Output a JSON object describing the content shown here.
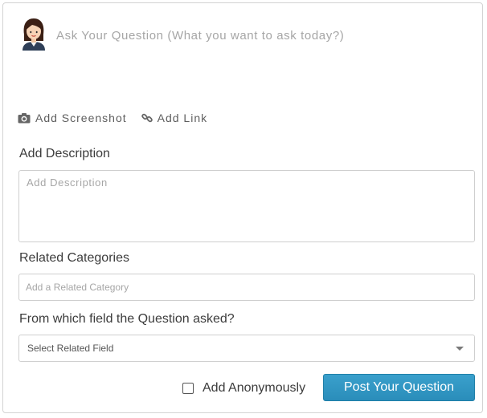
{
  "question": {
    "placeholder": "Ask Your Question (What you want to ask today?)",
    "value": ""
  },
  "attachments": {
    "screenshot_label": "Add Screenshot",
    "screenshot_icon": "camera-icon",
    "link_label": "Add Link",
    "link_icon": "link-icon"
  },
  "description": {
    "label": "Add Description",
    "placeholder": "Add Description",
    "value": ""
  },
  "categories": {
    "label": "Related Categories",
    "placeholder": "Add a Related Category",
    "value": ""
  },
  "field": {
    "label": "From which field the Question asked?",
    "selected": "Select Related Field"
  },
  "anonymous": {
    "label": "Add Anonymously",
    "checked": false
  },
  "submit": {
    "label": "Post Your Question"
  },
  "colors": {
    "accent": "#2f93c0",
    "border": "#d3d3d3",
    "label_text": "#3c3c3c",
    "placeholder": "#a6a6a6"
  }
}
